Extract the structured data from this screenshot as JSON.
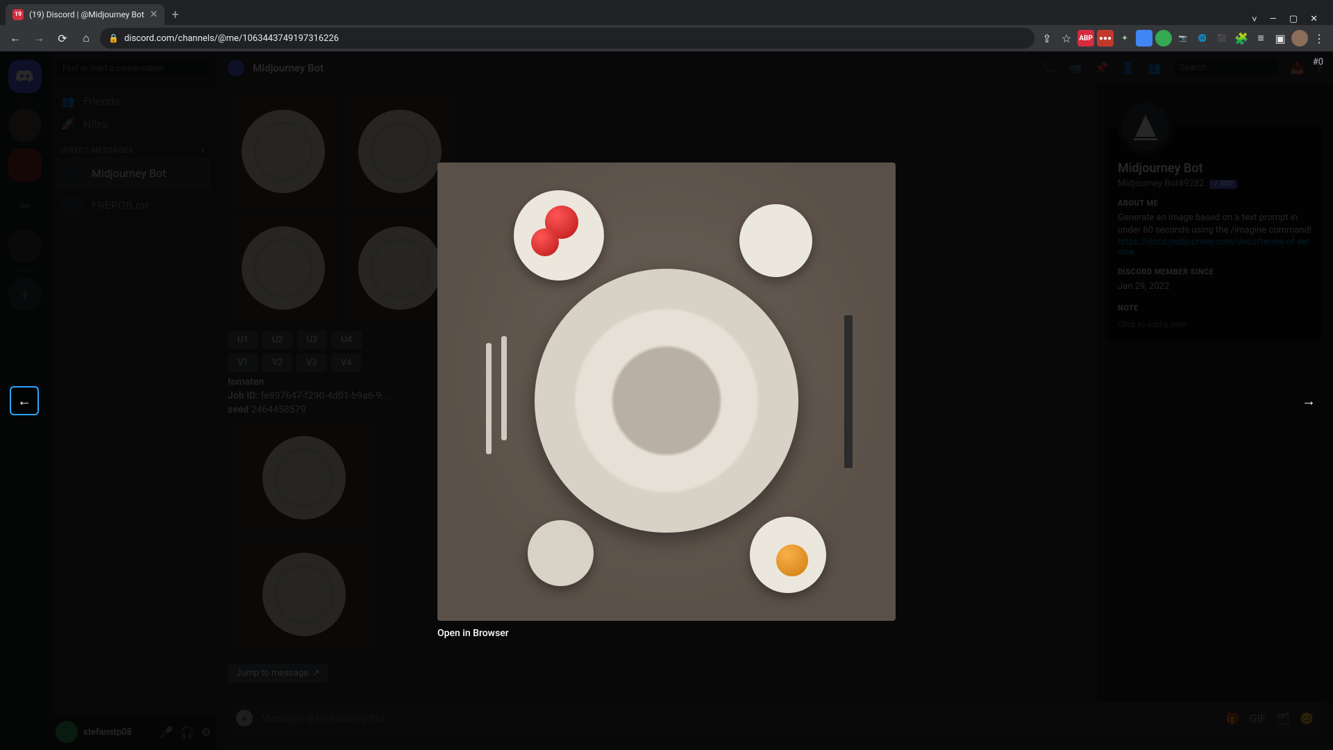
{
  "browser": {
    "tab_title": "(19) Discord | @Midjourney Bot",
    "url": "discord.com/channels/@me/1063443749197316226"
  },
  "window_controls": {
    "expand": "˅",
    "min": "—",
    "max": "▢",
    "close": "✕"
  },
  "discord": {
    "search_dm_placeholder": "Find or start a conversation",
    "sidebar": {
      "friends_label": "Friends",
      "nitro_label": "Nitro",
      "dm_heading": "DIRECT MESSAGES",
      "items": [
        {
          "label": "Midjourney Bot"
        },
        {
          "label": "FREPOB.rar"
        }
      ]
    },
    "user_panel": {
      "name": "stefanstp08",
      "status": ""
    },
    "channel": {
      "name": "Midjourney Bot",
      "search_placeholder": "Search"
    },
    "message": {
      "tomaten_label": "tomaten",
      "jobid_label": "Job ID:",
      "jobid_value": "fe897647-f290-4d01-b9a6-9...",
      "seed_label": "seed",
      "seed_value": "2464458579",
      "buttons_u": [
        "U1",
        "U2",
        "U3",
        "U4"
      ],
      "buttons_v": [
        "V1",
        "V2",
        "V3",
        "V4"
      ],
      "jump_label": "Jump to message"
    },
    "input_placeholder": "Message @Midjourney Bot",
    "profile": {
      "name": "Midjourney Bot",
      "tag": "Midjourney Bot#9282",
      "bot_badge": "✓ BOT",
      "about_heading": "ABOUT ME",
      "about_text": "Generate an image based on a text prompt in under 60 seconds using the /imagine command!",
      "link": "https://docs.midjourney.com/docs/terms-of-service",
      "member_heading": "DISCORD MEMBER SINCE",
      "member_date": "Jan 29, 2022",
      "note_heading": "NOTE",
      "note_placeholder": "Click to add a note",
      "hash_indicator": "#0"
    },
    "lightbox": {
      "open_in_browser": "Open in Browser"
    }
  }
}
